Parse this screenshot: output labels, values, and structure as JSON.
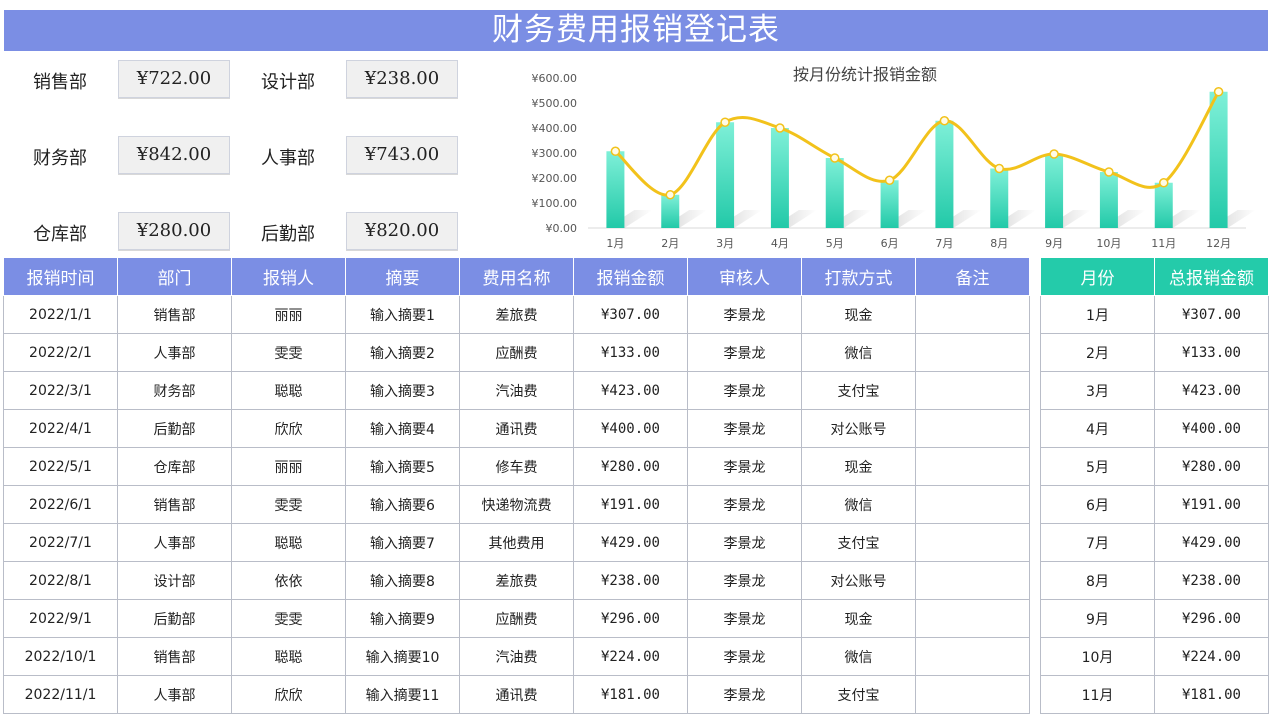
{
  "title": "财务费用报销登记表",
  "departments": [
    {
      "name": "销售部",
      "amount": "¥722.00"
    },
    {
      "name": "设计部",
      "amount": "¥238.00"
    },
    {
      "name": "财务部",
      "amount": "¥842.00"
    },
    {
      "name": "人事部",
      "amount": "¥743.00"
    },
    {
      "name": "仓库部",
      "amount": "¥280.00"
    },
    {
      "name": "后勤部",
      "amount": "¥820.00"
    }
  ],
  "chart_data": {
    "type": "bar",
    "title": "按月份统计报销金额",
    "categories": [
      "1月",
      "2月",
      "3月",
      "4月",
      "5月",
      "6月",
      "7月",
      "8月",
      "9月",
      "10月",
      "11月",
      "12月"
    ],
    "values": [
      307,
      133,
      423,
      400,
      280,
      191,
      429,
      238,
      296,
      224,
      181,
      545
    ],
    "overlay": "smooth-line",
    "ylim": [
      0,
      600
    ],
    "yticks": [
      "¥0.00",
      "¥100.00",
      "¥200.00",
      "¥300.00",
      "¥400.00",
      "¥500.00",
      "¥600.00"
    ],
    "grid": false,
    "colors": {
      "bar_top": "#7ff0d8",
      "bar_bottom": "#22c9a8",
      "line": "#f2c21b"
    }
  },
  "main_table": {
    "headers": [
      "报销时间",
      "部门",
      "报销人",
      "摘要",
      "费用名称",
      "报销金额",
      "审核人",
      "打款方式",
      "备注"
    ],
    "rows": [
      [
        "2022/1/1",
        "销售部",
        "丽丽",
        "输入摘要1",
        "差旅费",
        "¥307.00",
        "李景龙",
        "现金",
        ""
      ],
      [
        "2022/2/1",
        "人事部",
        "雯雯",
        "输入摘要2",
        "应酬费",
        "¥133.00",
        "李景龙",
        "微信",
        ""
      ],
      [
        "2022/3/1",
        "财务部",
        "聪聪",
        "输入摘要3",
        "汽油费",
        "¥423.00",
        "李景龙",
        "支付宝",
        ""
      ],
      [
        "2022/4/1",
        "后勤部",
        "欣欣",
        "输入摘要4",
        "通讯费",
        "¥400.00",
        "李景龙",
        "对公账号",
        ""
      ],
      [
        "2022/5/1",
        "仓库部",
        "丽丽",
        "输入摘要5",
        "修车费",
        "¥280.00",
        "李景龙",
        "现金",
        ""
      ],
      [
        "2022/6/1",
        "销售部",
        "雯雯",
        "输入摘要6",
        "快递物流费",
        "¥191.00",
        "李景龙",
        "微信",
        ""
      ],
      [
        "2022/7/1",
        "人事部",
        "聪聪",
        "输入摘要7",
        "其他费用",
        "¥429.00",
        "李景龙",
        "支付宝",
        ""
      ],
      [
        "2022/8/1",
        "设计部",
        "依依",
        "输入摘要8",
        "差旅费",
        "¥238.00",
        "李景龙",
        "对公账号",
        ""
      ],
      [
        "2022/9/1",
        "后勤部",
        "雯雯",
        "输入摘要9",
        "应酬费",
        "¥296.00",
        "李景龙",
        "现金",
        ""
      ],
      [
        "2022/10/1",
        "销售部",
        "聪聪",
        "输入摘要10",
        "汽油费",
        "¥224.00",
        "李景龙",
        "微信",
        ""
      ],
      [
        "2022/11/1",
        "人事部",
        "欣欣",
        "输入摘要11",
        "通讯费",
        "¥181.00",
        "李景龙",
        "支付宝",
        ""
      ]
    ]
  },
  "summary_table": {
    "headers": [
      "月份",
      "总报销金额"
    ],
    "rows": [
      [
        "1月",
        "¥307.00"
      ],
      [
        "2月",
        "¥133.00"
      ],
      [
        "3月",
        "¥423.00"
      ],
      [
        "4月",
        "¥400.00"
      ],
      [
        "5月",
        "¥280.00"
      ],
      [
        "6月",
        "¥191.00"
      ],
      [
        "7月",
        "¥429.00"
      ],
      [
        "8月",
        "¥238.00"
      ],
      [
        "9月",
        "¥296.00"
      ],
      [
        "10月",
        "¥224.00"
      ],
      [
        "11月",
        "¥181.00"
      ]
    ]
  }
}
